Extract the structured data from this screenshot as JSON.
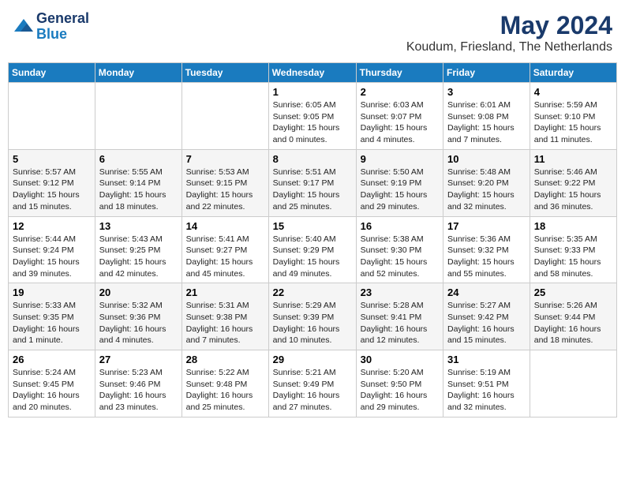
{
  "header": {
    "logo_line1": "General",
    "logo_line2": "Blue",
    "month_year": "May 2024",
    "location": "Koudum, Friesland, The Netherlands"
  },
  "weekdays": [
    "Sunday",
    "Monday",
    "Tuesday",
    "Wednesday",
    "Thursday",
    "Friday",
    "Saturday"
  ],
  "weeks": [
    [
      {
        "day": "",
        "info": ""
      },
      {
        "day": "",
        "info": ""
      },
      {
        "day": "",
        "info": ""
      },
      {
        "day": "1",
        "info": "Sunrise: 6:05 AM\nSunset: 9:05 PM\nDaylight: 15 hours\nand 0 minutes."
      },
      {
        "day": "2",
        "info": "Sunrise: 6:03 AM\nSunset: 9:07 PM\nDaylight: 15 hours\nand 4 minutes."
      },
      {
        "day": "3",
        "info": "Sunrise: 6:01 AM\nSunset: 9:08 PM\nDaylight: 15 hours\nand 7 minutes."
      },
      {
        "day": "4",
        "info": "Sunrise: 5:59 AM\nSunset: 9:10 PM\nDaylight: 15 hours\nand 11 minutes."
      }
    ],
    [
      {
        "day": "5",
        "info": "Sunrise: 5:57 AM\nSunset: 9:12 PM\nDaylight: 15 hours\nand 15 minutes."
      },
      {
        "day": "6",
        "info": "Sunrise: 5:55 AM\nSunset: 9:14 PM\nDaylight: 15 hours\nand 18 minutes."
      },
      {
        "day": "7",
        "info": "Sunrise: 5:53 AM\nSunset: 9:15 PM\nDaylight: 15 hours\nand 22 minutes."
      },
      {
        "day": "8",
        "info": "Sunrise: 5:51 AM\nSunset: 9:17 PM\nDaylight: 15 hours\nand 25 minutes."
      },
      {
        "day": "9",
        "info": "Sunrise: 5:50 AM\nSunset: 9:19 PM\nDaylight: 15 hours\nand 29 minutes."
      },
      {
        "day": "10",
        "info": "Sunrise: 5:48 AM\nSunset: 9:20 PM\nDaylight: 15 hours\nand 32 minutes."
      },
      {
        "day": "11",
        "info": "Sunrise: 5:46 AM\nSunset: 9:22 PM\nDaylight: 15 hours\nand 36 minutes."
      }
    ],
    [
      {
        "day": "12",
        "info": "Sunrise: 5:44 AM\nSunset: 9:24 PM\nDaylight: 15 hours\nand 39 minutes."
      },
      {
        "day": "13",
        "info": "Sunrise: 5:43 AM\nSunset: 9:25 PM\nDaylight: 15 hours\nand 42 minutes."
      },
      {
        "day": "14",
        "info": "Sunrise: 5:41 AM\nSunset: 9:27 PM\nDaylight: 15 hours\nand 45 minutes."
      },
      {
        "day": "15",
        "info": "Sunrise: 5:40 AM\nSunset: 9:29 PM\nDaylight: 15 hours\nand 49 minutes."
      },
      {
        "day": "16",
        "info": "Sunrise: 5:38 AM\nSunset: 9:30 PM\nDaylight: 15 hours\nand 52 minutes."
      },
      {
        "day": "17",
        "info": "Sunrise: 5:36 AM\nSunset: 9:32 PM\nDaylight: 15 hours\nand 55 minutes."
      },
      {
        "day": "18",
        "info": "Sunrise: 5:35 AM\nSunset: 9:33 PM\nDaylight: 15 hours\nand 58 minutes."
      }
    ],
    [
      {
        "day": "19",
        "info": "Sunrise: 5:33 AM\nSunset: 9:35 PM\nDaylight: 16 hours\nand 1 minute."
      },
      {
        "day": "20",
        "info": "Sunrise: 5:32 AM\nSunset: 9:36 PM\nDaylight: 16 hours\nand 4 minutes."
      },
      {
        "day": "21",
        "info": "Sunrise: 5:31 AM\nSunset: 9:38 PM\nDaylight: 16 hours\nand 7 minutes."
      },
      {
        "day": "22",
        "info": "Sunrise: 5:29 AM\nSunset: 9:39 PM\nDaylight: 16 hours\nand 10 minutes."
      },
      {
        "day": "23",
        "info": "Sunrise: 5:28 AM\nSunset: 9:41 PM\nDaylight: 16 hours\nand 12 minutes."
      },
      {
        "day": "24",
        "info": "Sunrise: 5:27 AM\nSunset: 9:42 PM\nDaylight: 16 hours\nand 15 minutes."
      },
      {
        "day": "25",
        "info": "Sunrise: 5:26 AM\nSunset: 9:44 PM\nDaylight: 16 hours\nand 18 minutes."
      }
    ],
    [
      {
        "day": "26",
        "info": "Sunrise: 5:24 AM\nSunset: 9:45 PM\nDaylight: 16 hours\nand 20 minutes."
      },
      {
        "day": "27",
        "info": "Sunrise: 5:23 AM\nSunset: 9:46 PM\nDaylight: 16 hours\nand 23 minutes."
      },
      {
        "day": "28",
        "info": "Sunrise: 5:22 AM\nSunset: 9:48 PM\nDaylight: 16 hours\nand 25 minutes."
      },
      {
        "day": "29",
        "info": "Sunrise: 5:21 AM\nSunset: 9:49 PM\nDaylight: 16 hours\nand 27 minutes."
      },
      {
        "day": "30",
        "info": "Sunrise: 5:20 AM\nSunset: 9:50 PM\nDaylight: 16 hours\nand 29 minutes."
      },
      {
        "day": "31",
        "info": "Sunrise: 5:19 AM\nSunset: 9:51 PM\nDaylight: 16 hours\nand 32 minutes."
      },
      {
        "day": "",
        "info": ""
      }
    ]
  ]
}
